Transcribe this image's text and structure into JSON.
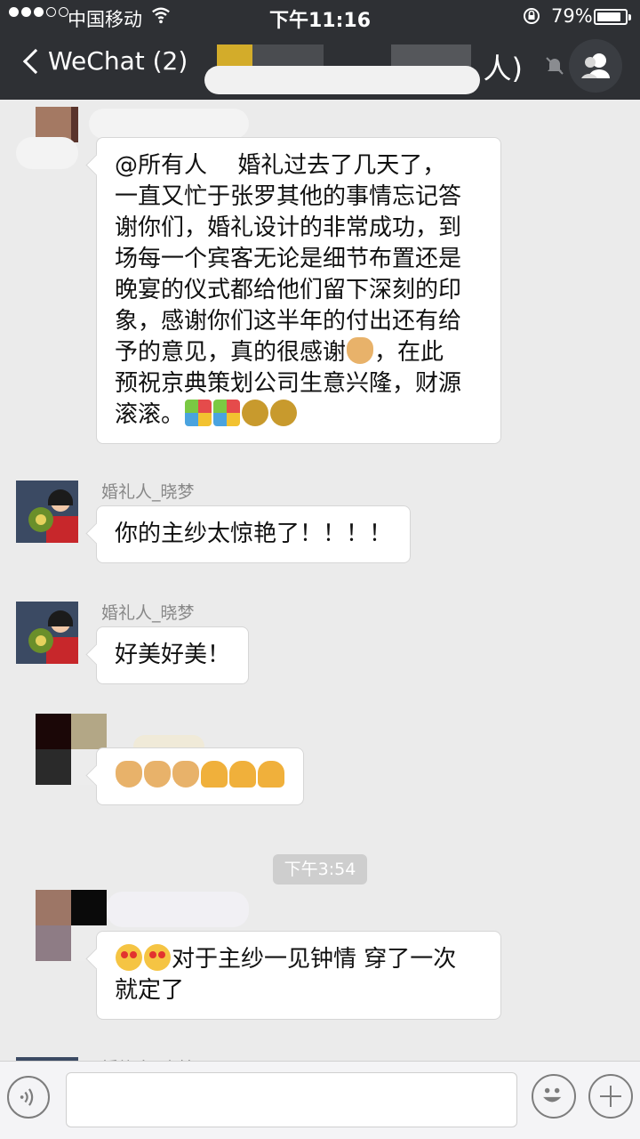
{
  "status_bar": {
    "carrier": "中国移动",
    "time": "下午11:16",
    "battery_percent": "79%",
    "battery_level": 0.79
  },
  "nav": {
    "back_label": "WeChat (2)",
    "title_visible": "人)"
  },
  "messages": [
    {
      "sender": "",
      "text_lines": [
        "@所有人　 婚礼过去了几天了，",
        "一直又忙于张罗其他的事情忘记答",
        "谢你们，婚礼设计的非常成功，到",
        "场每一个宾客无论是细节布置还是",
        "晚宴的仪式都给他们留下深刻的印",
        "象，感谢你们这半年的付出还有给"
      ],
      "line7_before_emoji": "予的意见，真的很感谢",
      "line7_after_emoji": "，在此",
      "line8": "预祝京典策划公司生意兴隆，财源",
      "line9": "滚滚。",
      "emojis": [
        "clapping-hands",
        "party-popper",
        "celebration",
        "money-bag",
        "money-bag"
      ]
    },
    {
      "sender": "婚礼人_晓梦",
      "text": "你的主纱太惊艳了！！！！"
    },
    {
      "sender": "婚礼人_晓梦",
      "text": "好美好美！"
    },
    {
      "sender": "",
      "emojis": [
        "clapping-hands",
        "clapping-hands",
        "clapping-hands",
        "praying-hands",
        "praying-hands",
        "praying-hands"
      ]
    },
    {
      "sender": "",
      "text_line1": "对于主纱一见钟情 穿了一次",
      "text_line2": "就定了",
      "emojis": [
        "heart-eyes",
        "heart-eyes"
      ]
    }
  ],
  "timestamp": "下午3:54",
  "partial_sender_bottom": "婚礼人_晓梦",
  "input_bar": {
    "icons": [
      "voice-icon",
      "emoji-icon",
      "plus-icon"
    ]
  }
}
